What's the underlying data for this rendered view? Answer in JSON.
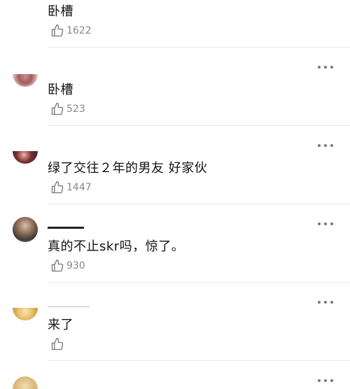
{
  "comments": [
    {
      "text": "卧槽",
      "likes": "1622"
    },
    {
      "text": "卧槽",
      "likes": "523"
    },
    {
      "text": "绿了交往２年的男友 好家伙",
      "likes": "1447"
    },
    {
      "text": "真的不止skr吗，惊了。",
      "likes": "930"
    },
    {
      "text": "来了",
      "likes": ""
    }
  ],
  "icons": {
    "like": "thumbs-up-icon",
    "more": "more-dots-icon"
  },
  "colors": {
    "text": "#111111",
    "muted": "#888888",
    "divider": "#e6e6e6"
  }
}
